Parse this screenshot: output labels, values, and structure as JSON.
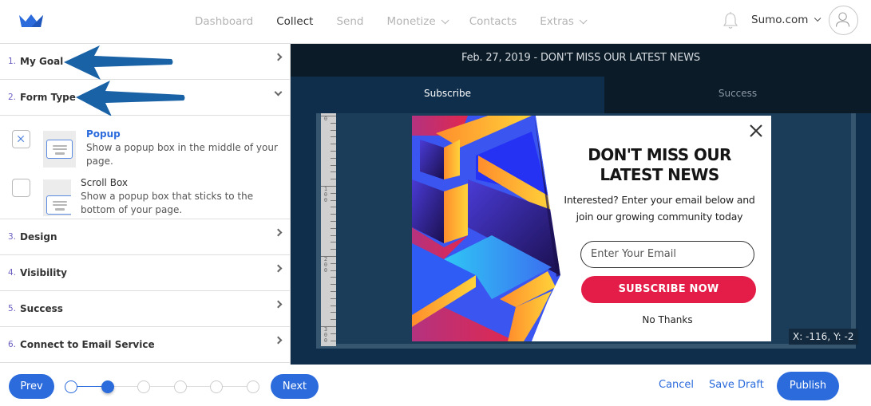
{
  "topbar": {
    "logo": "crown-logo",
    "nav": [
      {
        "label": "Dashboard",
        "active": false,
        "dropdown": false
      },
      {
        "label": "Collect",
        "active": true,
        "dropdown": false
      },
      {
        "label": "Send",
        "active": false,
        "dropdown": false
      },
      {
        "label": "Monetize",
        "active": false,
        "dropdown": true
      },
      {
        "label": "Contacts",
        "active": false,
        "dropdown": false
      },
      {
        "label": "Extras",
        "active": false,
        "dropdown": true
      }
    ],
    "account": "Sumo.com",
    "icons": {
      "notifications": "bell-icon",
      "profile": "user-avatar-icon"
    }
  },
  "sidebar": {
    "steps": [
      {
        "num": "1.",
        "label": "My Goal",
        "expanded": false
      },
      {
        "num": "2.",
        "label": "Form Type",
        "expanded": true
      },
      {
        "num": "3.",
        "label": "Design",
        "expanded": false
      },
      {
        "num": "4.",
        "label": "Visibility",
        "expanded": false
      },
      {
        "num": "5.",
        "label": "Success",
        "expanded": false
      },
      {
        "num": "6.",
        "label": "Connect to Email Service",
        "expanded": false
      }
    ],
    "form_types": [
      {
        "title": "Popup",
        "description": "Show a popup box in the middle of your page.",
        "selected": true
      },
      {
        "title": "Scroll Box",
        "description": "Show a popup box that sticks to the bottom of your page.",
        "selected": false
      }
    ]
  },
  "preview": {
    "header": "Feb. 27, 2019 - DON'T MISS OUR LATEST NEWS",
    "tabs": [
      {
        "label": "Subscribe",
        "active": true
      },
      {
        "label": "Success",
        "active": false
      }
    ],
    "ruler_labels": [
      "0",
      "100",
      "200",
      "300"
    ],
    "coords": "X: -116, Y: -2",
    "popup": {
      "title_line1": "DON'T MISS OUR",
      "title_line2": "LATEST NEWS",
      "text_line1": "Interested? Enter your email below and",
      "text_line2": "join our growing community today",
      "email_placeholder": "Enter Your Email",
      "subscribe_label": "SUBSCRIBE NOW",
      "no_thanks_label": "No Thanks",
      "accent_color": "#e31d47"
    }
  },
  "bottombar": {
    "prev_label": "Prev",
    "next_label": "Next",
    "progress": {
      "current_step": 2,
      "total_steps": 6
    },
    "cancel_label": "Cancel",
    "save_draft_label": "Save Draft",
    "publish_label": "Publish",
    "accent_color": "#2b6bdc"
  }
}
